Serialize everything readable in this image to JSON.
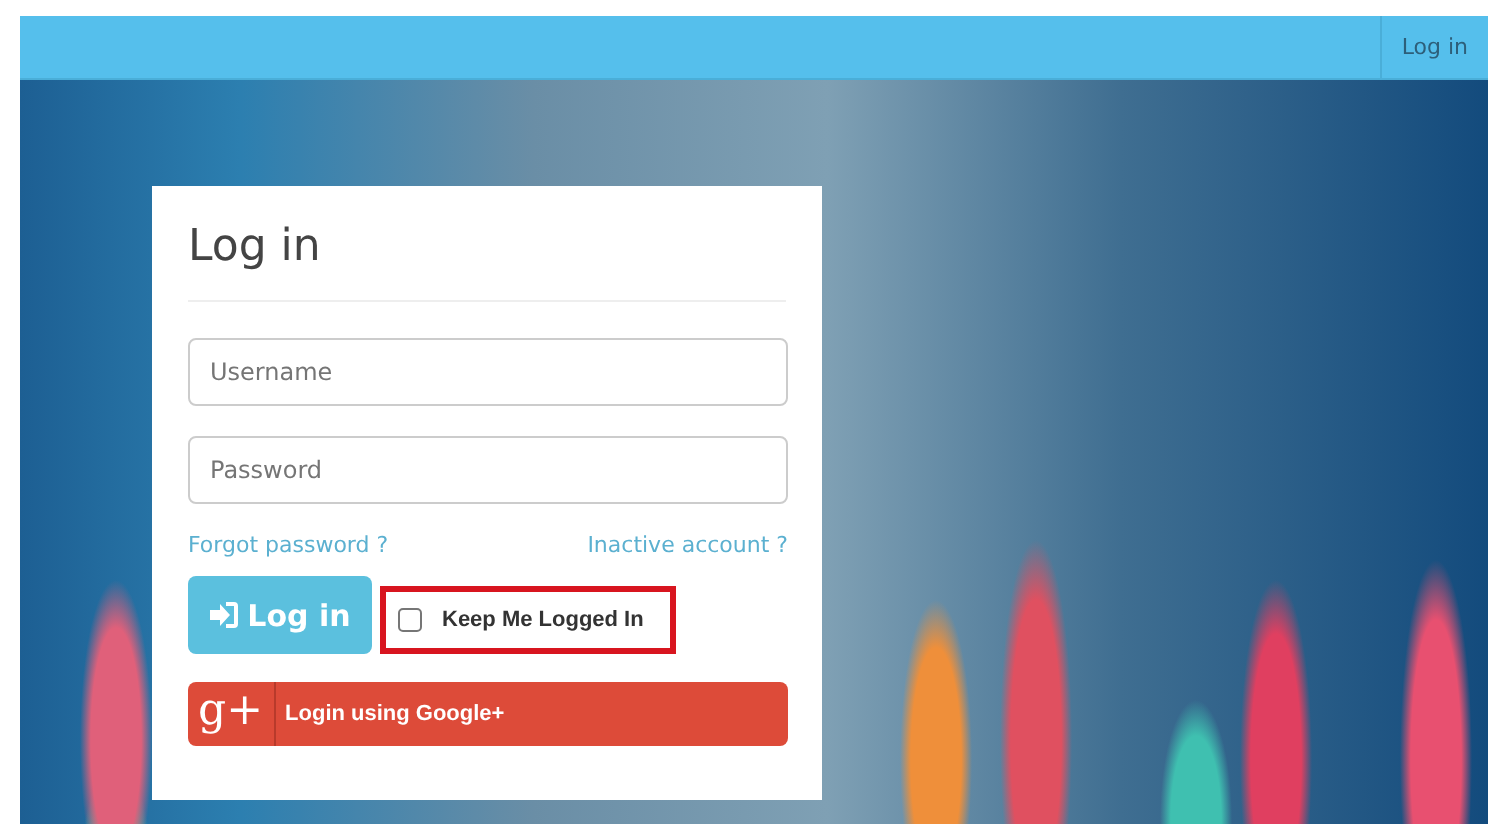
{
  "navbar": {
    "links": [
      {
        "label": "Log in",
        "selected": false
      }
    ]
  },
  "login_card": {
    "title": "Log in",
    "fields": [
      {
        "placeholder": "Username"
      },
      {
        "placeholder": "Password"
      }
    ],
    "links": [
      {
        "label": "Forgot password ?"
      },
      {
        "label": "Inactive account ?"
      }
    ],
    "submit_button": {
      "label": "Log in"
    },
    "remember": {
      "label": "Keep Me Logged In",
      "checked": false,
      "highlighted": true
    },
    "google_button": {
      "icon_text": "g+",
      "label": "Login using Google+"
    }
  }
}
